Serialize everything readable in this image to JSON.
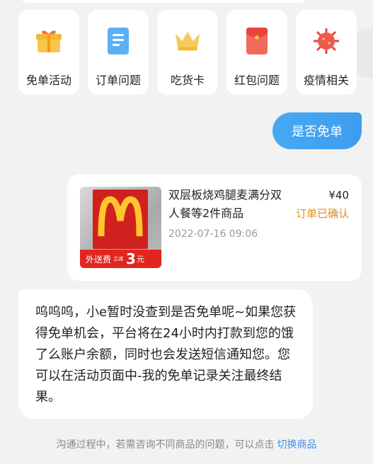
{
  "quick_actions": [
    {
      "label": "免单活动",
      "icon": "gift-icon",
      "color": "#f5b731"
    },
    {
      "label": "订单问题",
      "icon": "document-icon",
      "color": "#3d9cf0"
    },
    {
      "label": "吃货卡",
      "icon": "crown-icon",
      "color": "#f5b731"
    },
    {
      "label": "红包问题",
      "icon": "red-envelope-icon",
      "color": "#e8453c"
    },
    {
      "label": "疫情相关",
      "icon": "virus-icon",
      "color": "#e8453c"
    }
  ],
  "user_message": "是否免单",
  "order": {
    "title": "双层板烧鸡腿麦满分双人餐等2件商品",
    "time": "2022-07-16 09:06",
    "price": "¥40",
    "status": "订单已确认",
    "thumb_banner": "外送费",
    "thumb_fee_small": "立减",
    "thumb_fee": "3",
    "thumb_fee_unit": "元"
  },
  "bot_message": "呜呜呜，小e暂时没查到是否免单呢~如果您获得免单机会，平台将在24小时内打款到您的饿了么账户余额，同时也会发送短信通知您。您可以在活动页面中-我的免单记录关注最终结果。",
  "footer": {
    "text": "沟通过程中，若需咨询不同商品的问题，可以点击",
    "link": "切换商品"
  }
}
